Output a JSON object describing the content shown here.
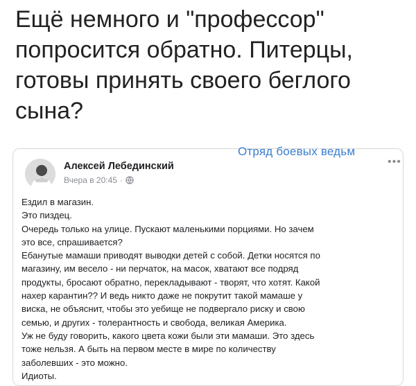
{
  "headline": {
    "lines": [
      "Ещё немного и \"профессор\"",
      "попросится обратно. Питерцы,",
      "готовы принять своего беглого",
      "сына?"
    ]
  },
  "watermark": "Отряд боевых ведьм",
  "post": {
    "author": "Алексей Лебединский",
    "time": "Вчера в 20:45",
    "separator": "·",
    "privacy_icon": "globe-icon",
    "more_label": "•••",
    "lines": [
      "Ездил в магазин.",
      "Это пиздец.",
      "Очередь только на улице. Пускают маленькими порциями. Но зачем",
      "это все, спрашивается?",
      "Ебанутые мамаши приводят выводки детей с собой. Детки носятся по",
      "магазину, им весело - ни перчаток, на масок, хватают все подряд",
      "продукты, бросают обратно, перекладывают - творят, что хотят. Какой",
      "нахер карантин?? И ведь никто даже не покрутит такой мамаше у",
      "виска, не объяснит, чтобы это уебище не подвергало риску и свою",
      "семью, и других - толерантность и свобода, великая Америка.",
      "Уж не буду говорить, какого цвета кожи были эти мамаши. Это здесь",
      "тоже нельзя. А быть на первом месте в мире по количеству",
      "заболевших - это можно.",
      "Идиоты."
    ]
  },
  "colors": {
    "watermark": "#3a7fd0",
    "meta_text": "#8a8d91",
    "card_border": "#d8d8d8"
  }
}
